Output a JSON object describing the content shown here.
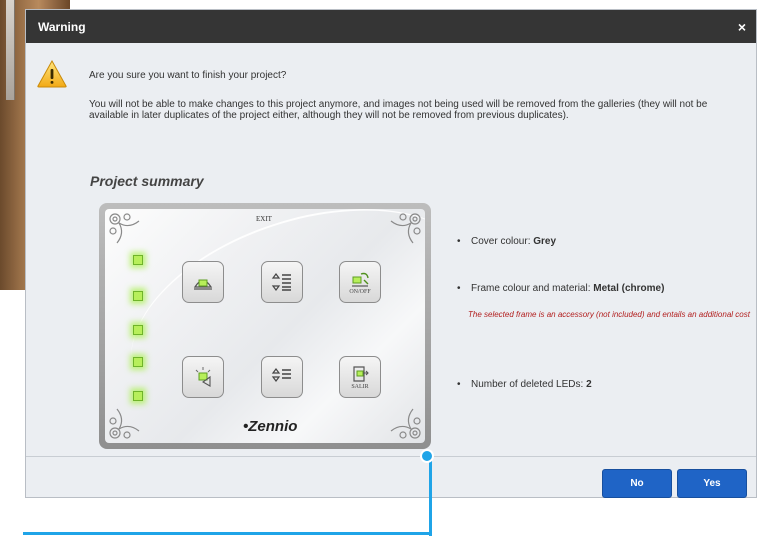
{
  "dialog": {
    "title": "Warning",
    "close_glyph": "×",
    "question": "Are you sure you want to finish your project?",
    "message": "You will not be able to make changes to this project anymore, and images not being used will be removed from the galleries (they will not be available in later duplicates of the project either, although they will not be removed from previous duplicates).",
    "icon": "warning-triangle-icon"
  },
  "summary": {
    "title": "Project summary",
    "preview": {
      "exit_label": "EXIT",
      "brand": "•Zennio",
      "tiles": [
        {
          "icon": "light-bulb-icon",
          "label": ""
        },
        {
          "icon": "blinds-up-down-icon",
          "label": ""
        },
        {
          "icon": "plant-on-off-icon",
          "label": "ON/OFF"
        },
        {
          "icon": "dimmer-lamp-icon",
          "label": ""
        },
        {
          "icon": "blinds-list-icon",
          "label": ""
        },
        {
          "icon": "exit-door-icon",
          "label": "SALIR"
        }
      ],
      "led_count": 5,
      "led_color": "#b7ef5a"
    },
    "items": [
      {
        "label": "Cover colour: ",
        "value": "Grey"
      },
      {
        "label": "Frame colour and material: ",
        "value": "Metal (chrome)"
      },
      {
        "label": "Number of deleted LEDs: ",
        "value": "2"
      }
    ],
    "frame_note": "The selected frame is an accessory (not included) and entails an additional cost"
  },
  "buttons": {
    "no": "No",
    "yes": "Yes"
  },
  "colors": {
    "titlebar": "#353535",
    "primary_button": "#1f64c6",
    "callout": "#1fa4e8",
    "note_text": "#b21e1e"
  }
}
